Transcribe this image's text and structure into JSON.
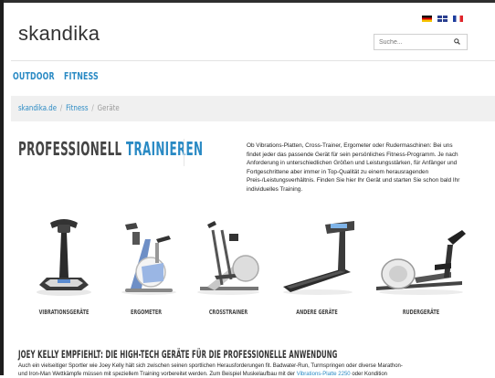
{
  "brand": {
    "logo": "skandika"
  },
  "languages": [
    "Deutsch",
    "English",
    "Français"
  ],
  "search": {
    "placeholder": "Suche..."
  },
  "nav": {
    "items": [
      "OUTDOOR",
      "FITNESS"
    ]
  },
  "breadcrumb": {
    "items": [
      "skandika.de",
      "Fitness",
      "Geräte"
    ],
    "separator": "/"
  },
  "hero": {
    "headline_part1": "PROFESSIONELL",
    "headline_part2": "TRAINIEREN",
    "intro": "Ob Vibrations-Platten, Cross-Trainer, Ergometer oder Rudermaschinen: Bei uns findet jeder das passende Gerät für sein persönliches Fitness-Programm. Je nach Anforderung in unterschiedlichen Größen und Leistungsstärken, für Anfänger und Fortgeschrittene aber immer in Top-Qualität zu einem herausragenden Preis-/Leistungsverhältnis. Finden Sie hier Ihr Gerät und starten Sie schon bald Ihr individuelles Training."
  },
  "products": [
    {
      "label": "VIBRATIONSGERÄTE",
      "icon": "vibration-plate-image"
    },
    {
      "label": "ERGOMETER",
      "icon": "exercise-bike-image"
    },
    {
      "label": "CROSSTRAINER",
      "icon": "crosstrainer-image"
    },
    {
      "label": "ANDERE GERÄTE",
      "icon": "treadmill-image"
    },
    {
      "label": "RUDERGERÄTE",
      "icon": "rowing-machine-image"
    }
  ],
  "article": {
    "heading": "JOEY KELLY EMPFIEHLT: DIE HIGH-TECH GERÄTE FÜR DIE PROFESSIONELLE ANWENDUNG",
    "line1": "Auch ein vielseitiger Sportler wie Joey Kelly hält sich zwischen seinen sportlichen Herausforderungen fit. Badwater-Run, Turmspringen oder diverse Marathon-",
    "line2_start": "und Iron-Man Wettkämpfe müssen mit speziellem Training vorbereitet werden. Zum Beispiel Muskelaufbau mit der",
    "line2_link": "Vibrations-Platte 2250",
    "line2_end": "oder Kondition"
  },
  "colors": {
    "accent": "#2a8ac4",
    "text": "#333333",
    "crumb_bg": "#f0f0f0"
  }
}
